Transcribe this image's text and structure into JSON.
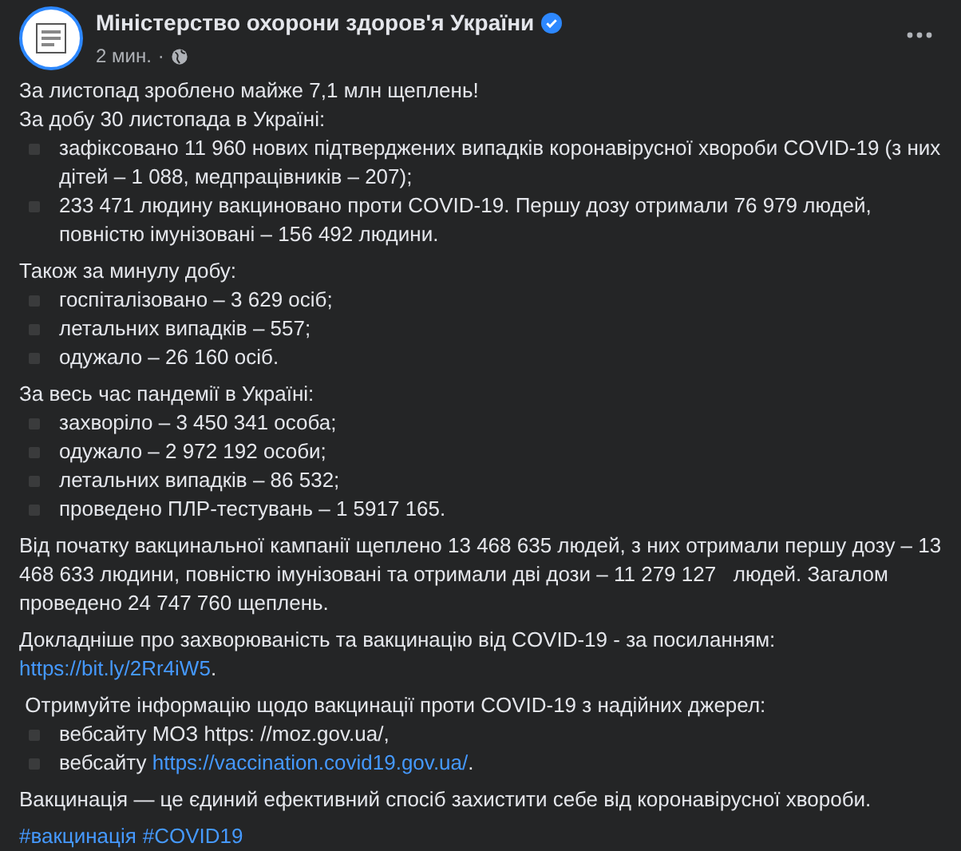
{
  "post": {
    "author": "Міністерство охорони здоров'я України",
    "verified": true,
    "time": "2 мин.",
    "separator": "·"
  },
  "paragraphs": [
    {
      "lines": [
        {
          "kind": "text",
          "segments": [
            {
              "kind": "plain",
              "text": "За листопад зроблено майже 7,1 млн щеплень!"
            }
          ]
        },
        {
          "kind": "text",
          "segments": [
            {
              "kind": "plain",
              "text": "За добу 30 листопада в Україні:"
            }
          ]
        },
        {
          "kind": "bullet",
          "segments": [
            {
              "kind": "plain",
              "text": "зафіксовано 11 960 нових підтверджених випадків коронавірусної хвороби COVID-19 (з них дітей – 1 088, медпрацівників – 207);"
            }
          ]
        },
        {
          "kind": "bullet",
          "segments": [
            {
              "kind": "plain",
              "text": "233 471 людину вакциновано проти COVID-19. Першу дозу отримали 76 979 людей, повністю імунізовані – 156 492 людини."
            }
          ]
        }
      ]
    },
    {
      "lines": [
        {
          "kind": "text",
          "segments": [
            {
              "kind": "plain",
              "text": "Також за минулу добу:"
            }
          ]
        },
        {
          "kind": "bullet",
          "segments": [
            {
              "kind": "plain",
              "text": "госпіталізовано – 3 629 осіб;"
            }
          ]
        },
        {
          "kind": "bullet",
          "segments": [
            {
              "kind": "plain",
              "text": "летальних випадків – 557;"
            }
          ]
        },
        {
          "kind": "bullet",
          "segments": [
            {
              "kind": "plain",
              "text": "одужало – 26 160 осіб."
            }
          ]
        }
      ]
    },
    {
      "lines": [
        {
          "kind": "text",
          "segments": [
            {
              "kind": "plain",
              "text": "За весь час пандемії в Україні:"
            }
          ]
        },
        {
          "kind": "bullet",
          "segments": [
            {
              "kind": "plain",
              "text": "захворіло – 3 450 341 особа;"
            }
          ]
        },
        {
          "kind": "bullet",
          "segments": [
            {
              "kind": "plain",
              "text": "одужало – 2 972 192 особи;"
            }
          ]
        },
        {
          "kind": "bullet",
          "segments": [
            {
              "kind": "plain",
              "text": "летальних випадків – 86 532;"
            }
          ]
        },
        {
          "kind": "bullet",
          "segments": [
            {
              "kind": "plain",
              "text": "проведено ПЛР-тестувань – 1 5917 165."
            }
          ]
        }
      ]
    },
    {
      "lines": [
        {
          "kind": "text",
          "segments": [
            {
              "kind": "plain",
              "text": "Від початку вакцинальної кампанії щеплено 13 468 635 людей, з них отримали першу дозу – 13 468 633 людини, повністю імунізовані та отримали дві дози – 11 279 127   людей. Загалом проведено 24 747 760 щеплень."
            }
          ]
        }
      ]
    },
    {
      "lines": [
        {
          "kind": "text",
          "segments": [
            {
              "kind": "plain",
              "text": "Докладніше про захворюваність та вакцинацію від COVID-19 - за посиланням:"
            }
          ]
        },
        {
          "kind": "text",
          "segments": [
            {
              "kind": "link",
              "text": "https://bit.ly/2Rr4iW5"
            },
            {
              "kind": "plain",
              "text": "."
            }
          ]
        }
      ]
    },
    {
      "lines": [
        {
          "kind": "text",
          "segments": [
            {
              "kind": "plain",
              "text": " Отримуйте інформацію щодо вакцинації проти COVID-19 з надійних джерел:"
            }
          ]
        },
        {
          "kind": "bullet",
          "segments": [
            {
              "kind": "plain",
              "text": "вебсайту МОЗ https: //moz.gov.ua/,"
            }
          ]
        },
        {
          "kind": "bullet",
          "segments": [
            {
              "kind": "plain",
              "text": "вебсайту "
            },
            {
              "kind": "link",
              "text": "https://vaccination.covid19.gov.ua/"
            },
            {
              "kind": "plain",
              "text": "."
            }
          ]
        }
      ]
    },
    {
      "lines": [
        {
          "kind": "text",
          "segments": [
            {
              "kind": "plain",
              "text": "Вакцинація — це єдиний ефективний спосіб захистити себе від коронавірусної хвороби."
            }
          ]
        }
      ]
    },
    {
      "lines": [
        {
          "kind": "hashtags",
          "segments": [
            {
              "kind": "link",
              "text": "#вакцинація"
            },
            {
              "kind": "link",
              "text": "#COVID19"
            }
          ]
        }
      ]
    }
  ]
}
